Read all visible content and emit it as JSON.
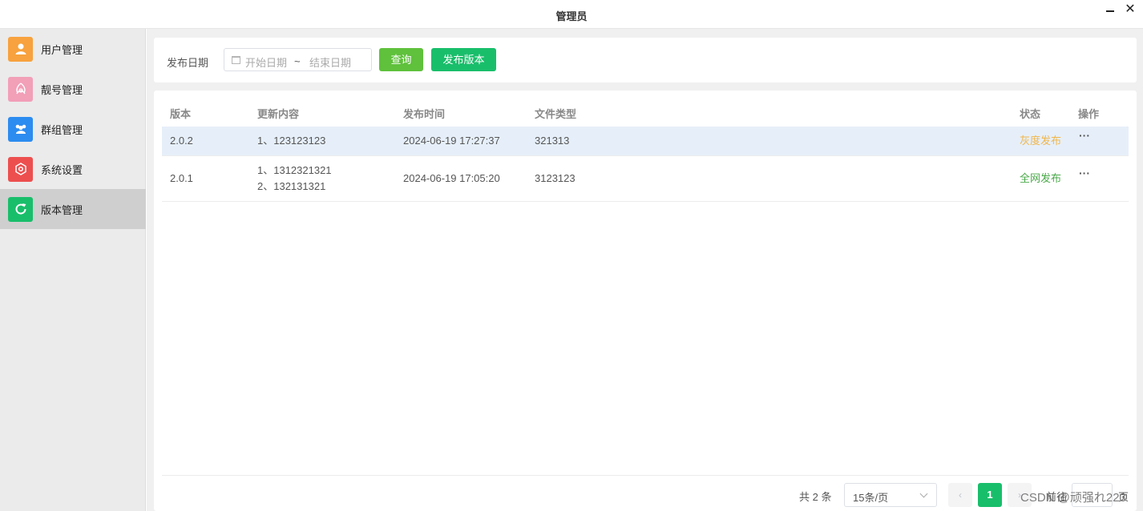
{
  "window": {
    "title": "管理员",
    "minimize": "—",
    "close": "✕"
  },
  "sidebar": {
    "items": [
      {
        "label": "用户管理",
        "icon": "user-icon",
        "color": "#f7a23e"
      },
      {
        "label": "靓号管理",
        "icon": "pretty-number-icon",
        "color": "#f29fb8"
      },
      {
        "label": "群组管理",
        "icon": "group-icon",
        "color": "#2d8cf0"
      },
      {
        "label": "系统设置",
        "icon": "settings-hexagon-icon",
        "color": "#ed4f4f"
      },
      {
        "label": "版本管理",
        "icon": "refresh-icon",
        "color": "#19be6b",
        "active": true
      }
    ]
  },
  "filter": {
    "label": "发布日期",
    "start_placeholder": "开始日期",
    "separator": "~",
    "end_placeholder": "结束日期",
    "query_label": "查询",
    "publish_label": "发布版本"
  },
  "table": {
    "columns": [
      "版本",
      "更新内容",
      "发布时间",
      "文件类型",
      "状态",
      "操作"
    ],
    "rows": [
      {
        "version": "2.0.2",
        "content": [
          "1、123123123"
        ],
        "time": "2024-06-19 17:27:37",
        "file_type": "321313",
        "status": "灰度发布",
        "status_color": "#f0b64c",
        "ops": "···"
      },
      {
        "version": "2.0.1",
        "content": [
          "1、1312321321",
          "2、132131321"
        ],
        "time": "2024-06-19 17:05:20",
        "file_type": "3123123",
        "status": "全网发布",
        "status_color": "#4aa84a",
        "ops": "···"
      }
    ]
  },
  "pagination": {
    "total": "共 2 条",
    "page_size": "15条/页",
    "prev": "‹",
    "current": "1",
    "next": "›",
    "goto_label": "前往",
    "goto_suffix": "页"
  },
  "watermark": "CSDN @顽强れ223"
}
